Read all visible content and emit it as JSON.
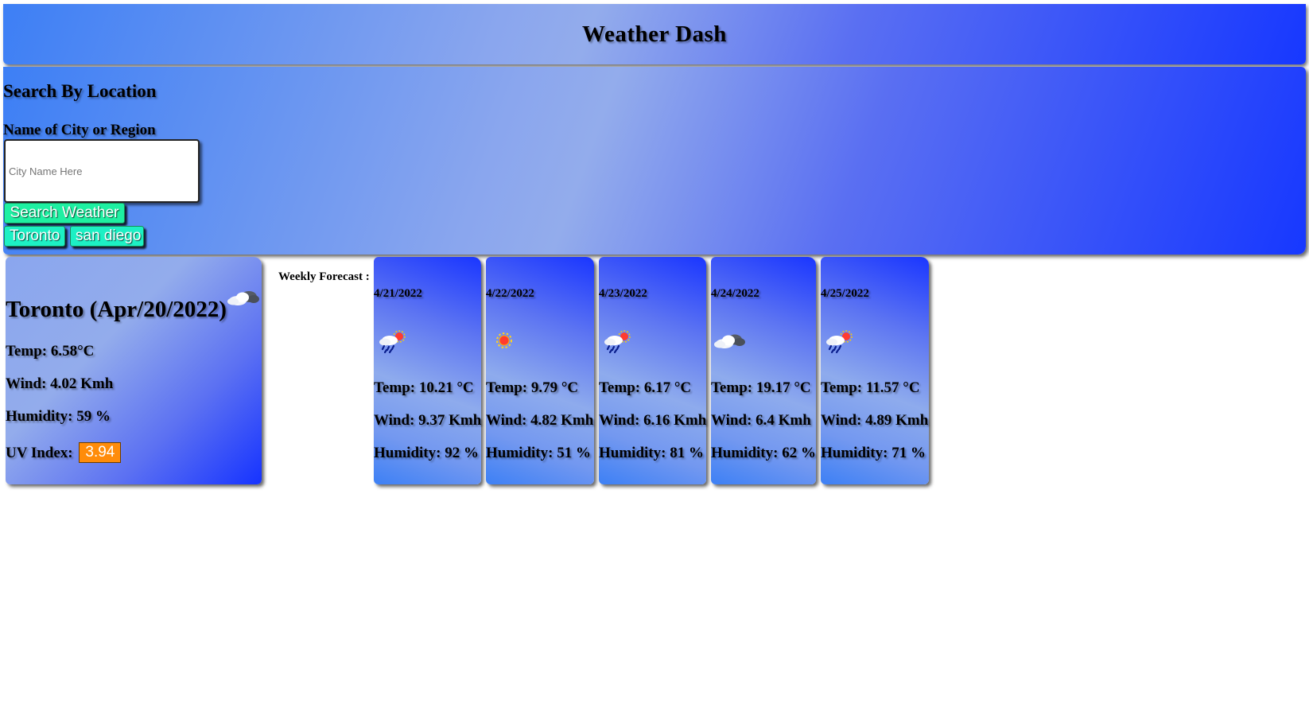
{
  "header": {
    "title": "Weather Dash"
  },
  "search": {
    "title": "Search By Location",
    "label": "Name of City or Region",
    "placeholder": "City Name Here",
    "button_label": "Search Weather",
    "history": [
      "Toronto",
      "san diego"
    ]
  },
  "today": {
    "city_date": "Toronto (Apr/20/2022)",
    "icon": "cloudy-icon",
    "temp": "Temp: 6.58°C",
    "wind": "Wind: 4.02 Kmh",
    "humidity": "Humidity: 59 %",
    "uv_label": "UV Index:",
    "uv_value": "3.94",
    "uv_color": "#ff8c0a"
  },
  "forecast": {
    "label": "Weekly Forecast :",
    "days": [
      {
        "date": "4/21/2022",
        "icon": "rain-sun-icon",
        "temp": "Temp: 10.21 °C",
        "wind": "Wind: 9.37 Kmh",
        "humidity": "Humidity: 92 %"
      },
      {
        "date": "4/22/2022",
        "icon": "sun-icon",
        "temp": "Temp: 9.79 °C",
        "wind": "Wind: 4.82 Kmh",
        "humidity": "Humidity: 51 %"
      },
      {
        "date": "4/23/2022",
        "icon": "rain-sun-icon",
        "temp": "Temp: 6.17 °C",
        "wind": "Wind: 6.16 Kmh",
        "humidity": "Humidity: 81 %"
      },
      {
        "date": "4/24/2022",
        "icon": "cloudy-icon",
        "temp": "Temp: 19.17 °C",
        "wind": "Wind: 6.4 Kmh",
        "humidity": "Humidity: 62 %"
      },
      {
        "date": "4/25/2022",
        "icon": "rain-sun-icon",
        "temp": "Temp: 11.57 °C",
        "wind": "Wind: 4.89 Kmh",
        "humidity": "Humidity: 71 %"
      }
    ]
  }
}
